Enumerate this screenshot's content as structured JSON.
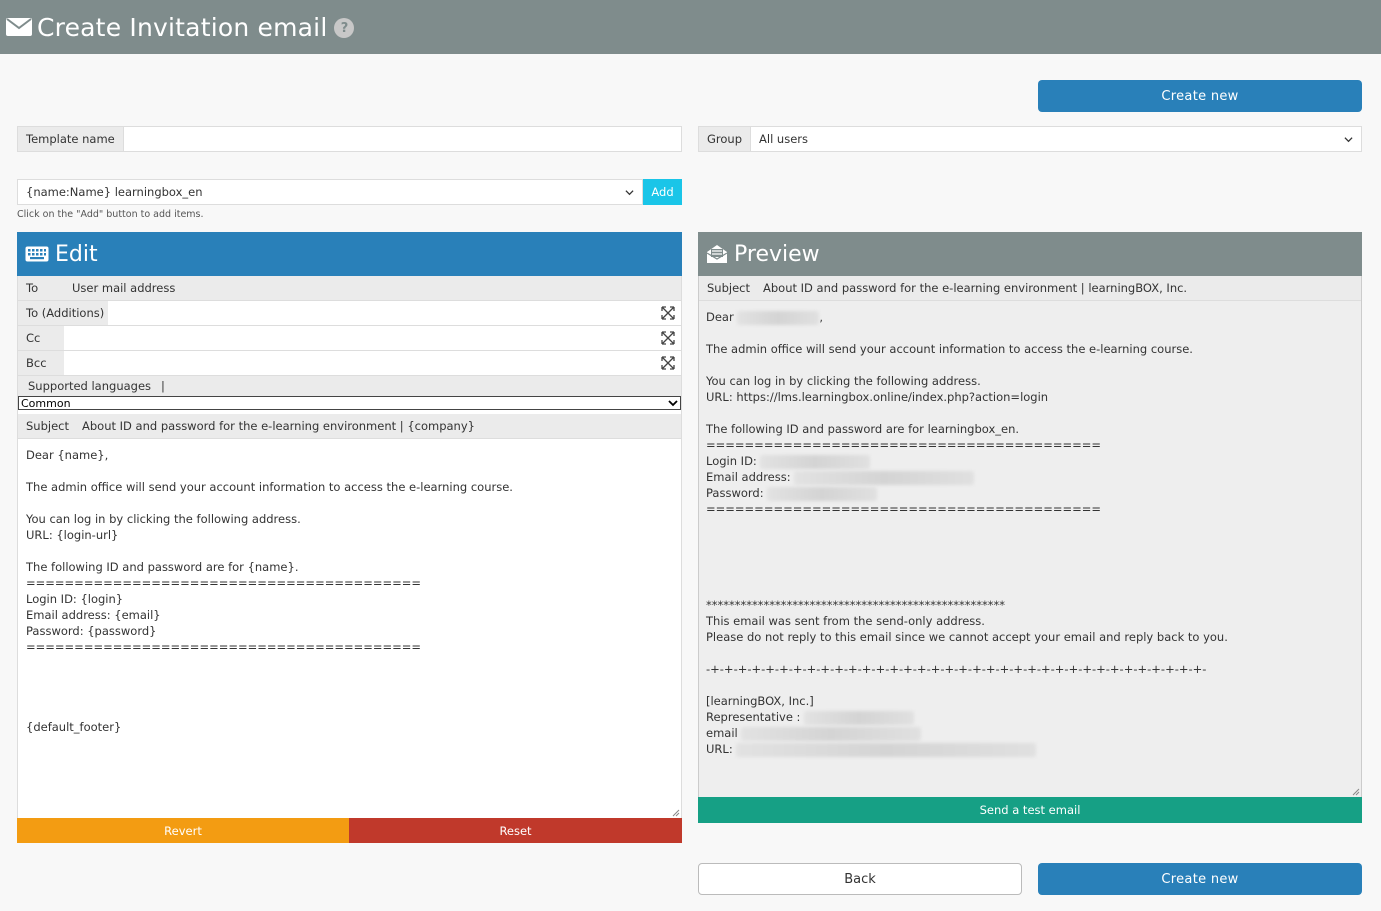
{
  "header": {
    "title": "Create Invitation email",
    "help": "?"
  },
  "buttons": {
    "create_new_top": "Create new",
    "create_new_bottom": "Create new",
    "back": "Back",
    "add": "Add",
    "revert": "Revert",
    "reset": "Reset",
    "send_test": "Send a test email"
  },
  "template": {
    "label": "Template name",
    "value": ""
  },
  "group": {
    "label": "Group",
    "value": "All users"
  },
  "item_select": {
    "value": "{name:Name} learningbox_en",
    "hint": "Click on the \"Add\" button to add items."
  },
  "edit": {
    "title": "Edit",
    "to_label": "To",
    "to_value": "User mail address",
    "to_add_label": "To (Additions)",
    "cc_label": "Cc",
    "bcc_label": "Bcc",
    "languages_label": "Supported languages",
    "languages_sep": "|",
    "language_value": "Common",
    "subject_label": "Subject",
    "subject_value": "About ID and password for the e-learning environment | {company}",
    "body": "Dear {name},\n\nThe admin office will send your account information to access the e-learning course.\n\nYou can log in by clicking the following address.\nURL: {login-url}\n\nThe following ID and password are for {name}.\n=========================================\nLogin ID: {login}\nEmail address: {email}\nPassword: {password}\n=========================================\n\n\n\n\n{default_footer}"
  },
  "preview": {
    "title": "Preview",
    "subject_label": "Subject",
    "subject_value": "About ID and password for the e-learning environment | learningBOX, Inc.",
    "dear": "Dear",
    "dear_end": ",",
    "line1": "The admin office will send your account information to access the e-learning course.",
    "line2": "You can log in by clicking the following address.",
    "line3": "URL: https://lms.learningbox.online/index.php?action=login",
    "line4": "The following ID and password are for learningbox_en.",
    "sep": "=========================================",
    "login_label": "Login ID:",
    "email_label": "Email address:",
    "password_label": "Password:",
    "stars": "****************************************************",
    "notice1": "This email was sent from the send-only address.",
    "notice2": "Please do not reply to this email since we cannot accept your email and reply back to you.",
    "plusline": "-+-+-+-+-+-+-+-+-+-+-+-+-+-+-+-+-+-+-+-+-+-+-+-+-+-+-+-+-+-+-+-+-+-+-+-+-",
    "company": "[learningBOX, Inc.]",
    "rep_label": "Representative :",
    "email_label2": "email",
    "url_label": "URL:"
  },
  "colors": {
    "header": "#7f8c8c",
    "primary": "#2980b9",
    "edit_header": "#2980b9",
    "preview_header": "#7f8c8c",
    "add": "#1ac5e8",
    "revert": "#f39c12",
    "reset": "#c0392b",
    "test": "#16a085"
  }
}
